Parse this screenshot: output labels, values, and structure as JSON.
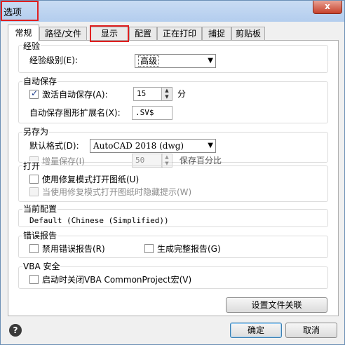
{
  "window": {
    "title": "选项",
    "close_label": "x"
  },
  "tabs": [
    "常规",
    "路径/文件",
    "显示",
    "配置",
    "正在打印",
    "捕捉",
    "剪贴板"
  ],
  "experience": {
    "group_label": "经验",
    "level_label": "经验级别(E):",
    "level_value": "高级"
  },
  "autosave": {
    "group_label": "自动保存",
    "activate_label": "激活自动保存(A):",
    "minutes_value": "15",
    "minutes_unit": "分",
    "ext_label": "自动保存图形扩展名(X):",
    "ext_value": ".SV$"
  },
  "saveas": {
    "group_label": "另存为",
    "format_label": "默认格式(D):",
    "format_value": "AutoCAD 2018 (dwg)",
    "incremental_label": "增量保存(I)",
    "incremental_value": "50",
    "percent_label": "保存百分比"
  },
  "open": {
    "group_label": "打开",
    "repair_label": "使用修复模式打开图纸(U)",
    "hide_label": "当使用修复模式打开图纸时隐藏提示(W)"
  },
  "profile": {
    "group_label": "当前配置",
    "value": "Default (Chinese (Simplified))"
  },
  "errors": {
    "group_label": "错误报告",
    "disable_label": "禁用错误报告(R)",
    "full_label": "生成完整报告(G)"
  },
  "vba": {
    "group_label": "VBA 安全",
    "close_label": "启动时关闭VBA CommonProject宏(V)"
  },
  "buttons": {
    "file_assoc": "设置文件关联",
    "ok": "确定",
    "cancel": "取消",
    "help": "?"
  }
}
